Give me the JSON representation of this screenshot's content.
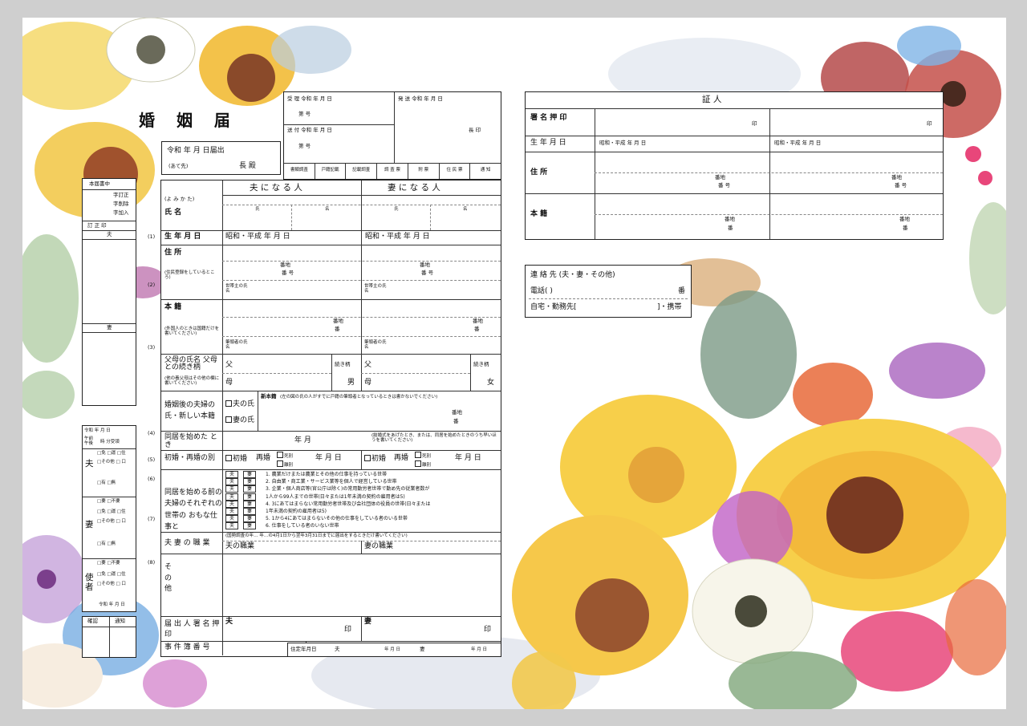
{
  "title": "婚 姻 届",
  "submission": {
    "date": "令和 年 月 日届出",
    "addressee_note": "(あて先)",
    "mayor": "長 殿"
  },
  "reception": {
    "received": "受 理 令和 年 月 日",
    "received_no": "第 号",
    "forwarded": "送 付 令和 年 月 日",
    "forwarded_no": "第 号",
    "sent": "発 送 令和 年 月 日",
    "sent_chief": "長 印",
    "columns": [
      "書類調査",
      "戸籍記載",
      "記載調査",
      "調 査 票",
      "附 票",
      "住 民 票",
      "通 知"
    ]
  },
  "correction": {
    "header": "本届書中",
    "line1": "字訂正",
    "line2": "字削除",
    "line3": "字加入",
    "stamp": "訂 正 印",
    "husband": "夫",
    "wife": "妻"
  },
  "form": {
    "col_husband": "夫 に な る 人",
    "col_wife": "妻 に な る 人",
    "yomikata": "(よ み か た)",
    "name": "氏 名",
    "surname": "氏",
    "given": "名",
    "birth": "生 年 月 日",
    "birth_value": "昭和・平成 年 月 日",
    "address": "住 所",
    "address_note": "(住民登録をしているところ)",
    "banchi": "番地",
    "ban_go": "番 号",
    "household_head": "世帯主の氏名",
    "honseki": "本 籍",
    "honseki_note": "(外国人のときは国籍だけを書いてください)",
    "ban": "番",
    "chief": "筆頭者の氏名",
    "parents": "父母の氏名 父母との続き柄",
    "parents_note": "(他の養父母はその他の欄に書いてください)",
    "father": "父",
    "mother": "母",
    "relation": "続き柄",
    "son": "男",
    "daughter": "女",
    "after_marriage": "婚姻後の夫婦の 氏・新しい本籍",
    "husband_surname": "夫の氏",
    "wife_surname": "妻の氏",
    "new_honseki": "新本籍",
    "new_honseki_note": "(左の図の氏の人がすでに戸籍の筆頭者となっているときは書かないでください)",
    "cohabit": "同居を始めた とき",
    "cohabit_value": "年 月",
    "cohabit_note": "(結婚式をあげたとき、または、同居を始めたときのうち早いほうを書いてください)",
    "marriage_type": "初婚・再婚の別",
    "first": "初婚",
    "re": "再婚",
    "death": "死別",
    "divorce": "離別",
    "ymd": "年 月 日",
    "household_work": "同居を始める前の夫婦のそれぞれの世帯の おもな仕事と",
    "work_items": [
      "1. 農業だけまたは農業とその他の仕事を持っている世帯",
      "2. 自由業・商工業・サービス業等を個人で経営している世帯",
      "3. 企業・個人商店等(官公庁は除く)の常用勤労者世帯で勤め先の従業者数が",
      "1人から99人までの世帯(日々または1年未満の契約の雇用者は5)",
      "4. 3にあてはまらない常用勤労者世帯及び会社団体の役員の世帯(日々または",
      "1年未満の契約の雇用者は5)",
      "5. 1から4にあてはまらないその他の仕事をしている者のいる世帯",
      "6. 仕事をしている者のいない世帯"
    ],
    "occupation": "夫 妻 の 職 業",
    "occupation_note": "(国勢調査の年… 年…の4月1日から翌年3月31日までに届出をするときだけ書いてください)",
    "husband_job": "夫の職業",
    "wife_job": "妻の職業",
    "other": "そ の 他",
    "signature": "届 出 人 署 名 押 印",
    "seal": "印",
    "case_no": "事 件 簿 番 号",
    "residence_date": "住定年月日",
    "husband": "夫",
    "wife": "妻",
    "ymd_short": "年 月 日",
    "row_numbers": [
      "(1)",
      "(2)",
      "(3)",
      "(4)",
      "(5)",
      "(6)",
      "(7)",
      "(8)"
    ]
  },
  "left_panel": {
    "date": "令和 年 月 日",
    "ampm": "午前 午後",
    "time": "時 分受領",
    "husband": "夫",
    "wife": "妻",
    "messenger": "使 者",
    "opts1": "□免 □運 □住",
    "opts2": "□その他 □ 口",
    "opts3": "□有 □無",
    "opts4": "□要 □不要",
    "confirm": "確認",
    "notify": "通知"
  },
  "witness": {
    "title": "証 人",
    "signature": "署 名 押 印",
    "seal": "印",
    "birth": "生 年 月 日",
    "birth_value": "昭和・平成 年 月 日",
    "address": "住 所",
    "honseki": "本 籍",
    "banchi": "番地",
    "ban_go": "番 号",
    "ban": "番"
  },
  "contact": {
    "title": "連 絡 先 (夫・妻・その他)",
    "phone": "電話( )",
    "phone_end": "番",
    "home": "自宅・勤務先[",
    "mobile": "]・携帯"
  },
  "colors": {
    "paper": "#ffffff",
    "border": "#222222",
    "yellow": "#f7cf4a",
    "brown": "#8a4a2a",
    "pink": "#e8467a",
    "orange": "#e86a3a",
    "leaf": "#7fa67a",
    "purple": "#9c4fb5",
    "blue": "#6fa8e0"
  }
}
